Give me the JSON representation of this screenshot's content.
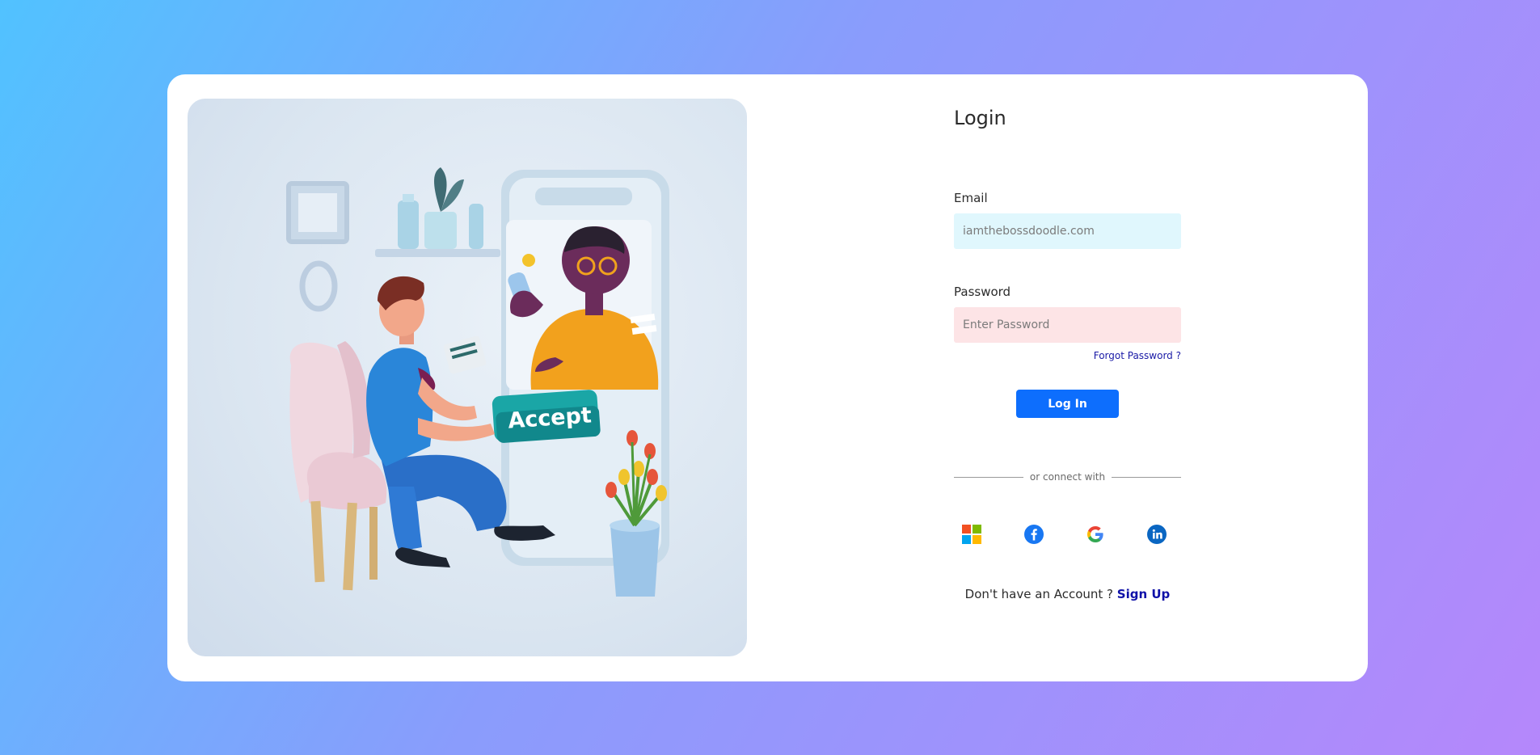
{
  "login": {
    "title": "Login",
    "email_label": "Email",
    "email_placeholder": "iamthebossdoodle.com",
    "password_label": "Password",
    "password_placeholder": "Enter Password",
    "forgot_password": "Forgot Password ?",
    "login_button": "Log In",
    "divider_text": "or connect with",
    "social": [
      {
        "name": "microsoft-icon"
      },
      {
        "name": "facebook-icon",
        "color": "#1877f2"
      },
      {
        "name": "google-icon"
      },
      {
        "name": "linkedin-icon",
        "color": "#0a66c2"
      }
    ],
    "signup_prompt": "Don't have an Account ?",
    "signup_link": "Sign Up"
  },
  "illustration": {
    "accept_label": "Accept"
  },
  "colors": {
    "primary": "#0d6efd",
    "link": "#1a1aa6",
    "email_bg": "#e0f7fd",
    "password_bg": "#fde4e6"
  }
}
